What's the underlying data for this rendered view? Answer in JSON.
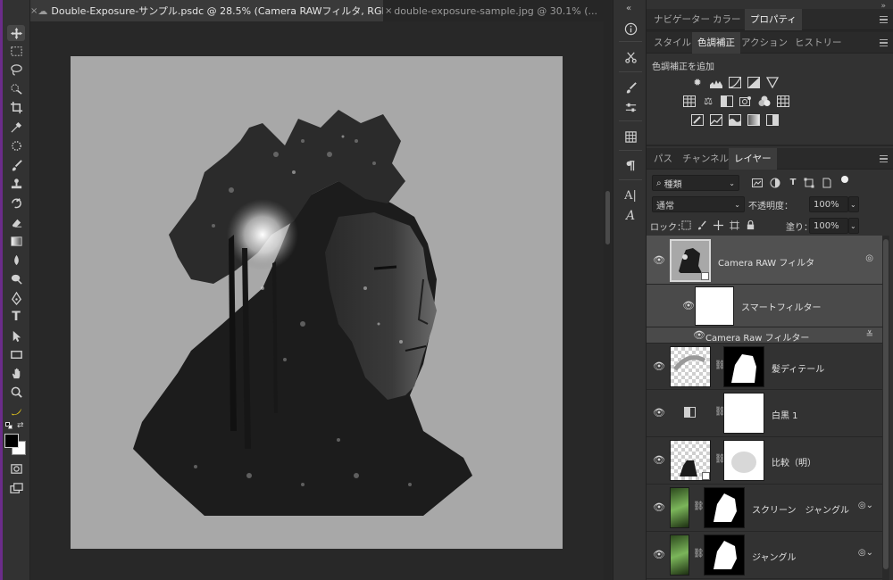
{
  "tabs": [
    {
      "title": "Double-Exposure-サンプル.psdc @ 28.5% (Camera RAWフィルタ, RGB/8) *",
      "close": "×",
      "active": true
    },
    {
      "title": "double-exposure-sample.jpg @ 30.1% (...",
      "close": "×",
      "active": false
    }
  ],
  "toolbar": {
    "tools": [
      "move-icon",
      "marquee-icon",
      "lasso-icon",
      "quick-select-icon",
      "crop-icon",
      "eyedropper-icon",
      "healing-icon",
      "brush-icon",
      "stamp-icon",
      "history-brush-icon",
      "eraser-icon",
      "gradient-icon",
      "blur-icon",
      "dodge-icon",
      "pen-icon",
      "type-icon",
      "path-select-icon",
      "rectangle-icon",
      "hand-icon",
      "zoom-icon",
      "banana-icon"
    ],
    "type_glyph": "T"
  },
  "strip": {
    "collapse": "«",
    "type_glyph_1": "A|",
    "type_glyph_2": "A"
  },
  "panels": {
    "top_tabs": [
      "ナビゲーター",
      "カラー",
      "プロパティ"
    ],
    "top_active": "プロパティ",
    "mid_tabs": [
      "スタイル",
      "色調補正",
      "アクション",
      "ヒストリー"
    ],
    "mid_active": "色調補正",
    "adjust_title": "色調補正を追加",
    "layer_tabs": [
      "パス",
      "チャンネル",
      "レイヤー"
    ],
    "layer_active": "レイヤー",
    "collapse": "»"
  },
  "layer_controls": {
    "filter_kind": "種類",
    "blend_mode": "通常",
    "opacity_label": "不透明度：",
    "opacity_value": "100%",
    "lock_label": "ロック：",
    "fill_label": "塗り：",
    "fill_value": "100%"
  },
  "layers": [
    {
      "name": "Camera RAW フィルタ",
      "selected": true
    },
    {
      "name": "スマートフィルター"
    },
    {
      "name": "Camera Raw フィルター"
    },
    {
      "name": "髪ディテール"
    },
    {
      "name": "白黒 1"
    },
    {
      "name": "比較（明）"
    },
    {
      "name": "スクリーン　ジャングル"
    },
    {
      "name": "ジャングル"
    }
  ],
  "colors": {
    "accent_purple": "#6b2c8a",
    "panel": "#323232",
    "canvas_bg": "#a8a8a8"
  }
}
